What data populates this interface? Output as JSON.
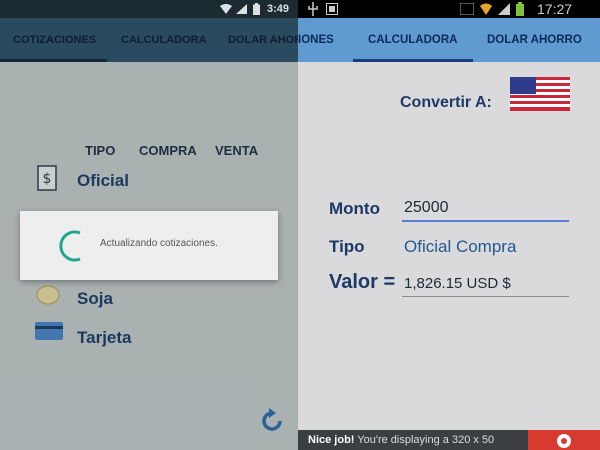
{
  "left": {
    "status": {
      "time": "3:49"
    },
    "tabs": [
      "COTIZACIONES",
      "CALCULADORA",
      "DOLAR AHORRO"
    ],
    "table_headers": {
      "tipo": "TIPO",
      "compra": "COMPRA",
      "venta": "VENTA"
    },
    "rows": [
      "Oficial",
      "Soja",
      "Tarjeta"
    ],
    "dialog": {
      "message": "Actualizando cotizaciones."
    }
  },
  "right": {
    "status": {
      "time": "17:27"
    },
    "tabs": [
      "IONES",
      "CALCULADORA",
      "DOLAR AHORRO"
    ],
    "convertir_label": "Convertir A:",
    "monto": {
      "label": "Monto",
      "value": "25000"
    },
    "tipo": {
      "label": "Tipo",
      "value": "Oficial Compra"
    },
    "valor": {
      "label": "Valor =",
      "value": "1,826.15 USD $"
    },
    "ad": {
      "bold": "Nice job!",
      "text": " You're displaying a 320 x 50"
    }
  },
  "colors": {
    "accent_blue": "#5f9bd0",
    "dark_tabs": "#2d4f68",
    "ad_red": "#d73a2f",
    "spinner": "#1fa68a"
  }
}
